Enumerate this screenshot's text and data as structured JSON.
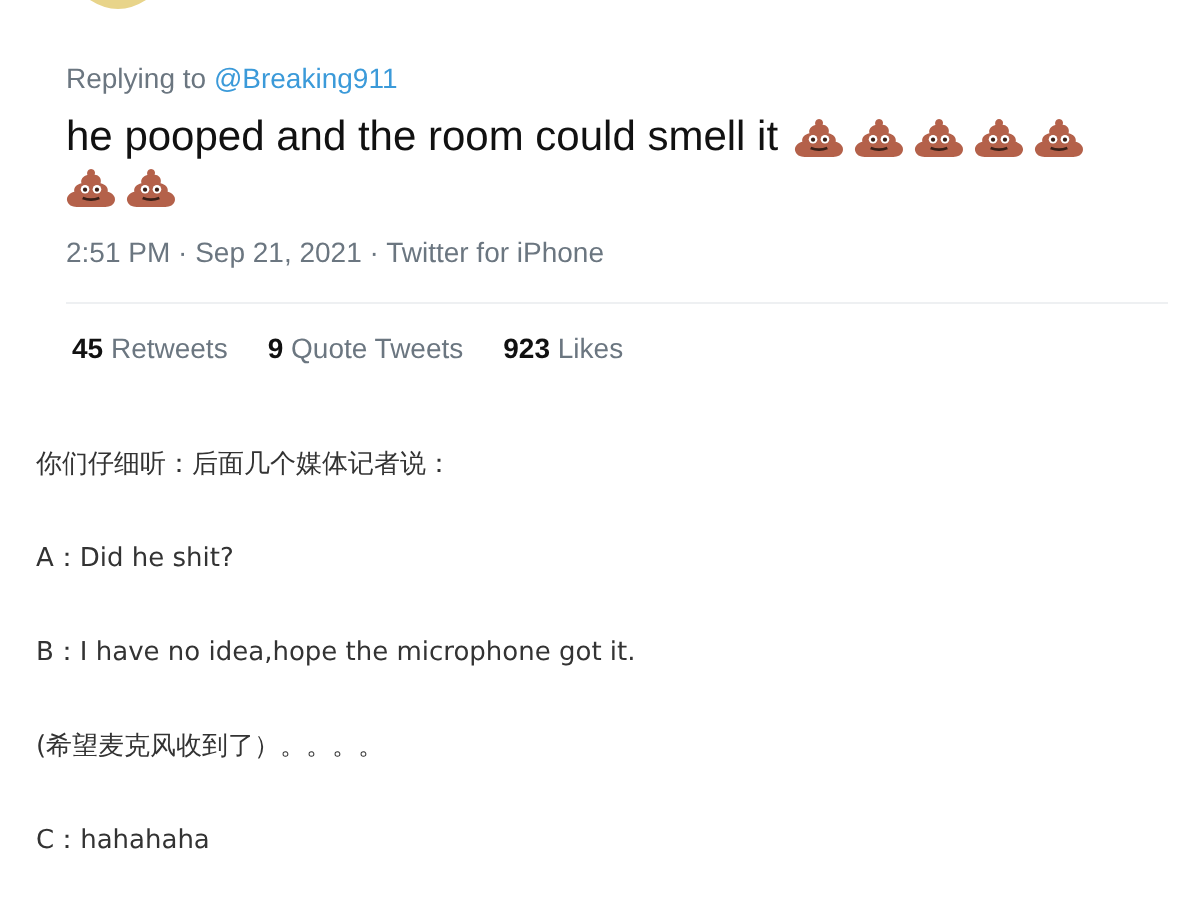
{
  "tweet": {
    "replying_label": "Replying to",
    "replying_handle": "@Breaking911",
    "text": "he pooped and the room could smell it",
    "timestamp": "2:51 PM · Sep 21, 2021 · Twitter for iPhone",
    "stats": [
      "**45** Retweets",
      "**9** Quote Tweets",
      "**923** Likes"
    ]
  },
  "article": {
    "paragraphs": [
      "你们仔细听：后面几个媒体记者说：",
      "A：Did he shit?",
      "B：I have no idea,hope the microphone got it.",
      "(希望麦克风收到了）。。。。",
      "C：hahahaha"
    ]
  }
}
